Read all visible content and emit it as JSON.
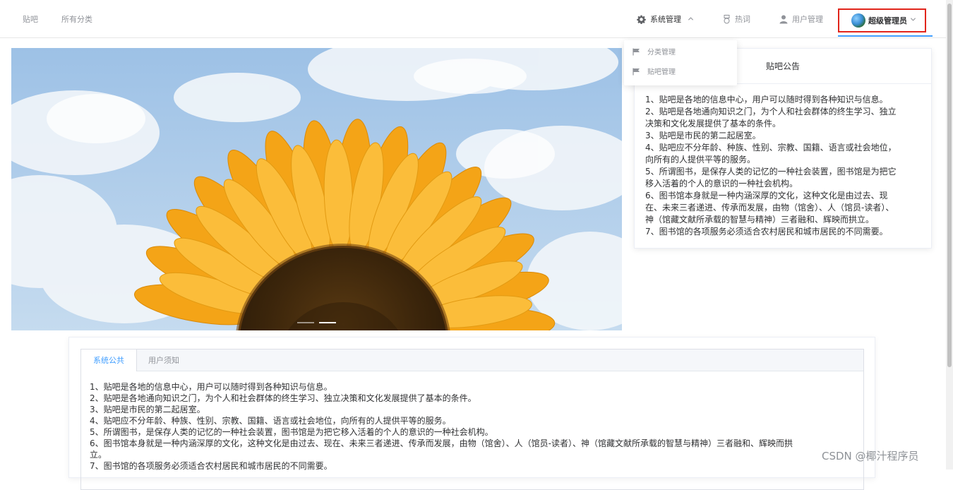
{
  "nav": {
    "left_links": [
      "贴吧",
      "所有分类"
    ],
    "system_menu": "系统管理",
    "hot_words": "热词",
    "user_manage": "用户管理",
    "user_name": "超级管理员"
  },
  "dropdown": {
    "items": [
      "分类管理",
      "贴吧管理"
    ]
  },
  "carousel": {
    "indicator_count": 2,
    "active_indicator": 2
  },
  "notice": {
    "title": "贴吧公告",
    "lines": [
      "1、贴吧是各地的信息中心，用户可以随时得到各种知识与信息。",
      "2、贴吧是各地通向知识之门，为个人和社会群体的终生学习、独立",
      "决策和文化发展提供了基本的条件。",
      "3、贴吧是市民的第二起居室。",
      "4、贴吧应不分年龄、种族、性别、宗教、国籍、语言或社会地位，",
      "向所有的人提供平等的服务。",
      "5、所谓图书，是保存人类的记忆的一种社会装置，图书馆是为把它",
      "移入活着的个人的意识的一种社会机构。",
      "6、图书馆本身就是一种内涵深厚的文化，这种文化是由过去、现",
      "在、未来三者递进、传承而发展，由物（馆舍）、人（馆员-读者）、",
      "神（馆藏文献所承载的智慧与精神）三者融和、辉映而拱立。",
      "7、图书馆的各项服务必须适合农村居民和城市居民的不同需要。"
    ]
  },
  "tabs": {
    "items": [
      "系统公共",
      "用户须知"
    ],
    "active": 0,
    "content": [
      "1、贴吧是各地的信息中心，用户可以随时得到各种知识与信息。",
      "2、贴吧是各地通向知识之门，为个人和社会群体的终生学习、独立决策和文化发展提供了基本的条件。",
      "3、贴吧是市民的第二起居室。",
      "4、贴吧应不分年龄、种族、性别、宗教、国籍、语言或社会地位，向所有的人提供平等的服务。",
      "5、所谓图书，是保存人类的记忆的一种社会装置，图书馆是为把它移入活着的个人的意识的一种社会机构。",
      "6、图书馆本身就是一种内涵深厚的文化，这种文化是由过去、现在、未来三者递进、传承而发展，由物（馆舍）、人（馆员-读者）、神（馆藏文献所承载的智慧与精神）三者融和、辉映而拱",
      "立。",
      "7、图书馆的各项服务必须适合农村居民和城市居民的不同需要。"
    ]
  },
  "watermark": "CSDN @椰汁程序员",
  "colors": {
    "accent": "#409eff",
    "highlight_border": "#e1251b",
    "petal": "#f4a417",
    "sky": "#a9c9e8"
  }
}
